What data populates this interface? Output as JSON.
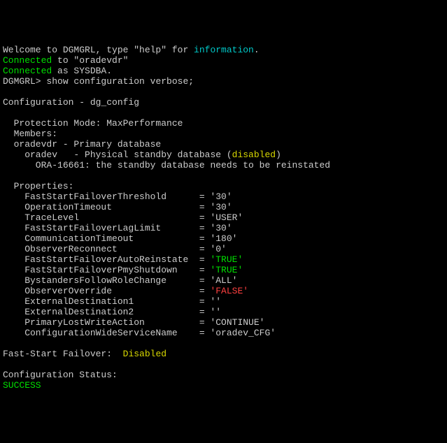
{
  "welcome": {
    "prefix": "Welcome to DGMGRL, type \"help\" for ",
    "link": "information",
    "suffix": "."
  },
  "conn1": {
    "word": "Connected",
    "rest": " to \"oradevdr\""
  },
  "conn2": {
    "word": "Connected",
    "rest": " as SYSDBA."
  },
  "prompt": "DGMGRL> ",
  "command": "show configuration verbose;",
  "cfgTitle": "Configuration - dg_config",
  "protMode": "  Protection Mode: MaxPerformance",
  "membersHdr": "  Members:",
  "primaryLine": "  oradevdr - Primary database",
  "standbyPre": "    oradev   - Physical standby database (",
  "standbyWord": "disabled",
  "standbyPost": ")",
  "oraMsg": "      ORA-16661: the standby database needs to be reinstated",
  "propsHdr": "  Properties:",
  "props": [
    {
      "name": "FastStartFailoverThreshold",
      "pad": "     ",
      "val": "'30'",
      "cls": ""
    },
    {
      "name": "OperationTimeout",
      "pad": "               ",
      "val": "'30'",
      "cls": ""
    },
    {
      "name": "TraceLevel",
      "pad": "                     ",
      "val": "'USER'",
      "cls": ""
    },
    {
      "name": "FastStartFailoverLagLimit",
      "pad": "      ",
      "val": "'30'",
      "cls": ""
    },
    {
      "name": "CommunicationTimeout",
      "pad": "           ",
      "val": "'180'",
      "cls": ""
    },
    {
      "name": "ObserverReconnect",
      "pad": "              ",
      "val": "'0'",
      "cls": ""
    },
    {
      "name": "FastStartFailoverAutoReinstate",
      "pad": " ",
      "val": "'TRUE'",
      "cls": "green"
    },
    {
      "name": "FastStartFailoverPmyShutdown",
      "pad": "   ",
      "val": "'TRUE'",
      "cls": "green"
    },
    {
      "name": "BystandersFollowRoleChange",
      "pad": "     ",
      "val": "'ALL'",
      "cls": ""
    },
    {
      "name": "ObserverOverride",
      "pad": "               ",
      "val": "'FALSE'",
      "cls": "red"
    },
    {
      "name": "ExternalDestination1",
      "pad": "           ",
      "val": "''",
      "cls": ""
    },
    {
      "name": "ExternalDestination2",
      "pad": "           ",
      "val": "''",
      "cls": ""
    },
    {
      "name": "PrimaryLostWriteAction",
      "pad": "         ",
      "val": "'CONTINUE'",
      "cls": ""
    },
    {
      "name": "ConfigurationWideServiceName",
      "pad": "   ",
      "val": "'oradev_CFG'",
      "cls": ""
    }
  ],
  "fsf": {
    "label": "Fast-Start Failover:  ",
    "value": "Disabled"
  },
  "statusHdr": "Configuration Status:",
  "statusVal": "SUCCESS"
}
